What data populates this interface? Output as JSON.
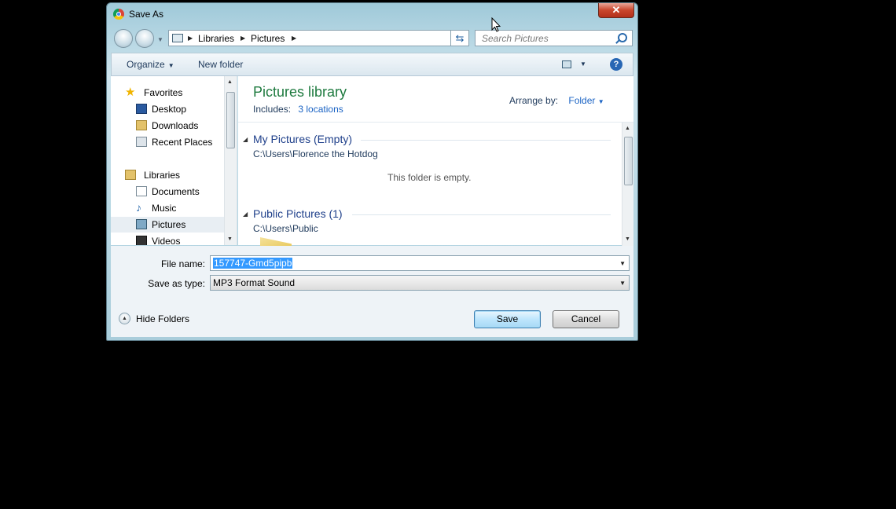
{
  "window": {
    "title": "Save As",
    "close_label": "✕"
  },
  "address": {
    "crumbs": [
      "Libraries",
      "Pictures"
    ]
  },
  "search": {
    "placeholder": "Search Pictures"
  },
  "toolbar": {
    "organize": "Organize",
    "new_folder": "New folder",
    "help": "?"
  },
  "nav": {
    "favorites": "Favorites",
    "favorites_items": [
      "Desktop",
      "Downloads",
      "Recent Places"
    ],
    "libraries": "Libraries",
    "libraries_items": [
      "Documents",
      "Music",
      "Pictures",
      "Videos"
    ],
    "selected": "Pictures"
  },
  "content": {
    "title": "Pictures library",
    "includes_label": "Includes:",
    "includes_link": "3 locations",
    "arrange_label": "Arrange by:",
    "arrange_value": "Folder",
    "groups": [
      {
        "header": "My Pictures (Empty)",
        "path": "C:\\Users\\Florence the Hotdog",
        "message": "This folder is empty."
      },
      {
        "header": "Public Pictures (1)",
        "path": "C:\\Users\\Public"
      }
    ]
  },
  "form": {
    "file_name_label": "File name:",
    "file_name_value": "157747-Gmd5pipb",
    "save_type_label": "Save as type:",
    "save_type_value": "MP3 Format Sound"
  },
  "buttons": {
    "hide_folders": "Hide Folders",
    "save": "Save",
    "cancel": "Cancel"
  },
  "colors": {
    "library_title": "#1e7a3f",
    "link": "#1a63c4",
    "selection": "#3399ff"
  }
}
